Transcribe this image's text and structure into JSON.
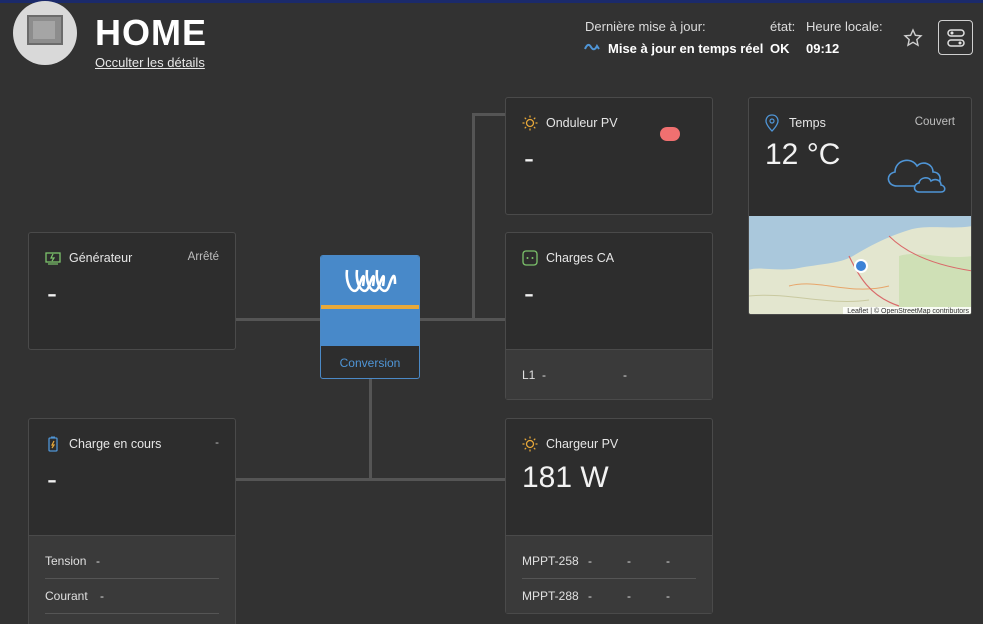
{
  "header": {
    "title": "HOME",
    "hide_details": "Occulter les détails",
    "last_update_label": "Dernière mise à jour:",
    "last_update_value": "Mise à jour en temps réel",
    "state_label": "état:",
    "state_value": "OK",
    "local_time_label": "Heure locale:",
    "local_time_value": "09:12"
  },
  "generator": {
    "title": "Générateur",
    "status": "Arrêté",
    "value": "-"
  },
  "pv_inverter": {
    "title": "Onduleur PV",
    "value": "-"
  },
  "ac_loads": {
    "title": "Charges CA",
    "value": "-",
    "l1_label": "L1",
    "l1_value_a": "-",
    "l1_value_b": "-"
  },
  "battery": {
    "title": "Charge en cours",
    "status": "-",
    "value": "-",
    "voltage_label": "Tension",
    "voltage_value": "-",
    "current_label": "Courant",
    "current_value": "-"
  },
  "pv_charger": {
    "title": "Chargeur PV",
    "value": "181 W",
    "rows": [
      {
        "label": "MPPT-258",
        "a": "-",
        "b": "-",
        "c": "-"
      },
      {
        "label": "MPPT-288",
        "a": "-",
        "b": "-",
        "c": "-"
      }
    ]
  },
  "inverter": {
    "label": "Conversion"
  },
  "weather": {
    "title": "Temps",
    "condition": "Couvert",
    "temperature": "12 °C",
    "map_attribution": "Leaflet | © OpenStreetMap contributors"
  },
  "colors": {
    "accent": "#4889c9",
    "orange": "#e8a93a",
    "background": "#323232",
    "card": "#2d2d2d"
  }
}
